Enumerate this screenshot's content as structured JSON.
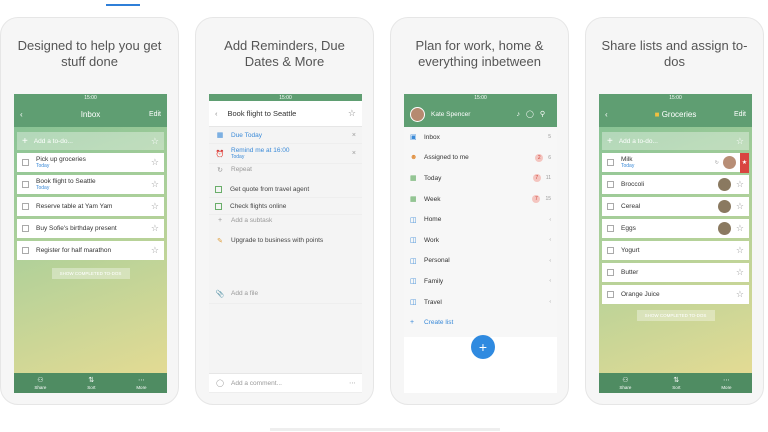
{
  "colors": {
    "accent_green": "#5f9e72",
    "link_blue": "#3a8ad8",
    "star_red": "#d94540"
  },
  "cards": [
    {
      "caption": "Designed to help you get stuff done"
    },
    {
      "caption": "Add Reminders, Due Dates & More"
    },
    {
      "caption": "Plan for work, home & everything inbetween"
    },
    {
      "caption": "Share lists and assign to-dos"
    }
  ],
  "status_time": "15:00",
  "inbox": {
    "title": "Inbox",
    "edit": "Edit",
    "add_placeholder": "Add a to-do...",
    "tasks": [
      {
        "title": "Pick up groceries",
        "due": "Today"
      },
      {
        "title": "Book flight to Seattle",
        "due": "Today"
      },
      {
        "title": "Reserve table at Yam Yam",
        "due": ""
      },
      {
        "title": "Buy Sofie's birthday present",
        "due": ""
      },
      {
        "title": "Register for half marathon",
        "due": ""
      }
    ],
    "show_completed": "SHOW COMPLETED TO-DOS",
    "tabs": [
      "Share",
      "Sort",
      "More"
    ]
  },
  "detail": {
    "title": "Book flight to Seattle",
    "due": "Due Today",
    "remind": "Remind me at 16:00",
    "remind_sub": "Today",
    "repeat": "Repeat",
    "subtasks": [
      "Get quote from travel agent",
      "Check flights online"
    ],
    "add_subtask": "Add a subtask",
    "note": "Upgrade to business with points",
    "add_file": "Add a file",
    "add_comment": "Add a comment..."
  },
  "sidebar": {
    "user": "Kate Spencer",
    "items": [
      {
        "label": "Inbox",
        "icon": "inbox-icon",
        "badge": "",
        "count": "5"
      },
      {
        "label": "Assigned to me",
        "icon": "person-icon",
        "badge": "2",
        "count": "6"
      },
      {
        "label": "Today",
        "icon": "calendar-icon",
        "badge": "7",
        "count": "11"
      },
      {
        "label": "Week",
        "icon": "calendar-icon",
        "badge": "7",
        "count": "15"
      },
      {
        "label": "Home",
        "icon": "folder-icon",
        "badge": "",
        "count": ""
      },
      {
        "label": "Work",
        "icon": "folder-icon",
        "badge": "",
        "count": ""
      },
      {
        "label": "Personal",
        "icon": "folder-icon",
        "badge": "",
        "count": ""
      },
      {
        "label": "Family",
        "icon": "folder-icon",
        "badge": "",
        "count": ""
      },
      {
        "label": "Travel",
        "icon": "folder-icon",
        "badge": "",
        "count": ""
      }
    ],
    "create_list": "Create list"
  },
  "groceries": {
    "title": "Groceries",
    "edit": "Edit",
    "add_placeholder": "Add a to-do...",
    "items": [
      {
        "title": "Milk",
        "due": "Today"
      },
      {
        "title": "Broccoli",
        "due": ""
      },
      {
        "title": "Cereal",
        "due": ""
      },
      {
        "title": "Eggs",
        "due": ""
      },
      {
        "title": "Yogurt",
        "due": ""
      },
      {
        "title": "Butter",
        "due": ""
      },
      {
        "title": "Orange Juice",
        "due": ""
      }
    ],
    "show_completed": "SHOW COMPLETED TO-DOS",
    "tabs": [
      "Share",
      "Sort",
      "More"
    ]
  }
}
